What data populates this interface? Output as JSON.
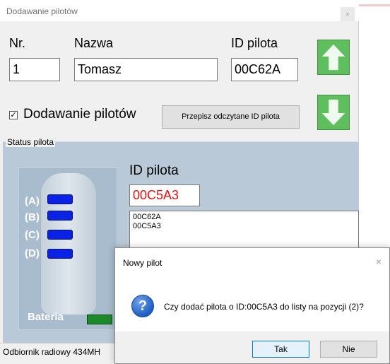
{
  "main_window": {
    "title": "Dodawanie pilotów",
    "close_glyph": "×",
    "form": {
      "nr_label": "Nr.",
      "nr_value": "1",
      "name_label": "Nazwa",
      "name_value": "Tomasz",
      "remote_id_label": "ID pilota",
      "remote_id_value": "00C62A"
    },
    "up_button_icon": "arrow-up-icon",
    "down_button_icon": "arrow-down-icon",
    "add_checkbox": {
      "checked": true,
      "mark": "✓",
      "label": "Dodawanie pilotów"
    },
    "copy_button_label": "Przepisz odczytane ID pilota",
    "status_group": {
      "caption": "Status pilota",
      "keys": [
        "(A)",
        "(B)",
        "(C)",
        "(D)"
      ],
      "led_color": "#0a22e6",
      "battery_label": "Bateria",
      "battery_color": "#1d8a2a",
      "id_heading": "ID pilota",
      "id_read_value": "00C5A3",
      "id_read_color": "#e81010",
      "id_list": [
        "00C62A",
        "00C5A3"
      ]
    },
    "status_bar_text": "Odbiornik radiowy 434MH"
  },
  "dialog": {
    "title": "Nowy pilot",
    "close_glyph": "×",
    "icon": "question-icon",
    "icon_glyph": "?",
    "message": "Czy dodać pilota o ID:00C5A3 do listy na pozycji (2)?",
    "yes_label": "Tak",
    "no_label": "Nie"
  },
  "colors": {
    "accent_green": "#5fbf5f",
    "group_background": "#b9c9d8",
    "focus_blue": "#0078d7"
  }
}
